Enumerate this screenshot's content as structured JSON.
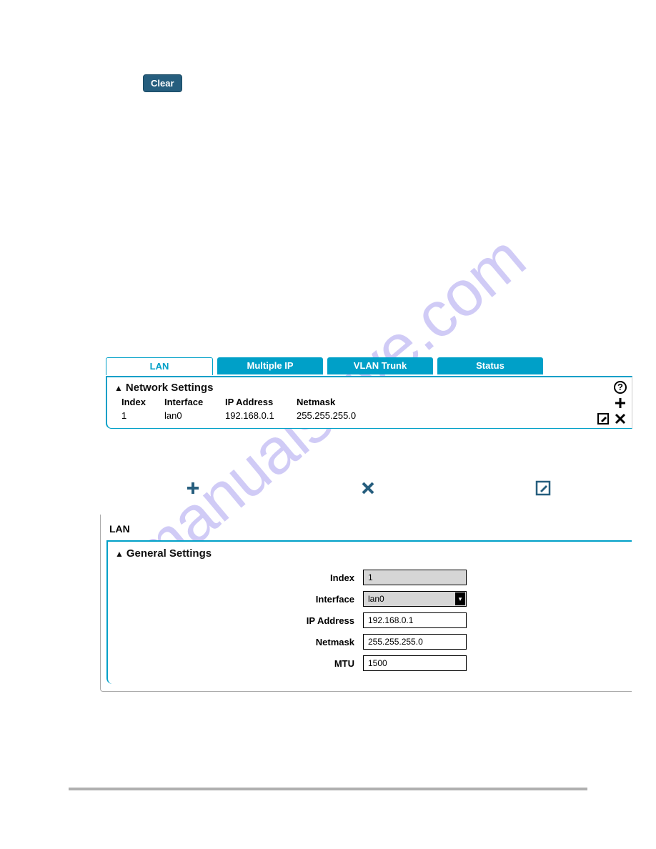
{
  "watermark": "manualshive.com",
  "clear_button": "Clear",
  "tabs": [
    {
      "label": "LAN"
    },
    {
      "label": "Multiple IP"
    },
    {
      "label": "VLAN Trunk"
    },
    {
      "label": "Status"
    }
  ],
  "network_panel": {
    "title": "Network Settings",
    "headers": {
      "index": "Index",
      "interface": "Interface",
      "ip": "IP Address",
      "netmask": "Netmask"
    },
    "rows": [
      {
        "index": "1",
        "interface": "lan0",
        "ip": "192.168.0.1",
        "netmask": "255.255.255.0"
      }
    ]
  },
  "lan": {
    "title": "LAN",
    "general_title": "General Settings",
    "form": {
      "index_label": "Index",
      "index_value": "1",
      "interface_label": "Interface",
      "interface_value": "lan0",
      "ip_label": "IP Address",
      "ip_value": "192.168.0.1",
      "netmask_label": "Netmask",
      "netmask_value": "255.255.255.0",
      "mtu_label": "MTU",
      "mtu_value": "1500"
    }
  }
}
